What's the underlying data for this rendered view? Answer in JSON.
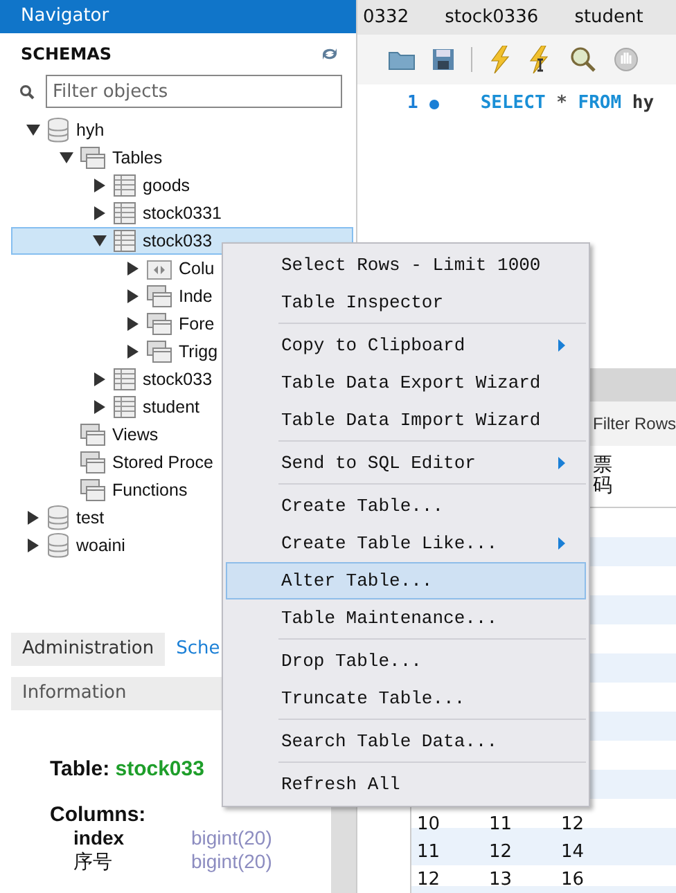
{
  "navigator": {
    "title": "Navigator",
    "section": "SCHEMAS",
    "filter": {
      "placeholder": "Filter objects"
    }
  },
  "tree": [
    {
      "label": "hyh",
      "kind": "schema",
      "expanded": true,
      "selected": false,
      "children": [
        {
          "label": "Tables",
          "kind": "folder",
          "expanded": true,
          "selected": false,
          "children": [
            {
              "label": "goods",
              "kind": "table",
              "expanded": false,
              "selected": false
            },
            {
              "label": "stock0331",
              "kind": "table",
              "expanded": false,
              "selected": false
            },
            {
              "label": "stock033",
              "kind": "table",
              "expanded": true,
              "selected": true,
              "children": [
                {
                  "label": "Colu",
                  "kind": "columns",
                  "expanded": false,
                  "selected": false
                },
                {
                  "label": "Inde",
                  "kind": "folder",
                  "expanded": false,
                  "selected": false
                },
                {
                  "label": "Fore",
                  "kind": "folder",
                  "expanded": false,
                  "selected": false
                },
                {
                  "label": "Trigg",
                  "kind": "folder",
                  "expanded": false,
                  "selected": false
                }
              ]
            },
            {
              "label": "stock033",
              "kind": "table",
              "expanded": false,
              "selected": false
            },
            {
              "label": "student",
              "kind": "table",
              "expanded": false,
              "selected": false
            }
          ]
        },
        {
          "label": "Views",
          "kind": "leaf",
          "selected": false
        },
        {
          "label": "Stored Proce",
          "kind": "leaf",
          "selected": false
        },
        {
          "label": "Functions",
          "kind": "leaf",
          "selected": false
        }
      ]
    },
    {
      "label": "test",
      "kind": "schema",
      "expanded": false,
      "selected": false
    },
    {
      "label": "woaini",
      "kind": "schema",
      "expanded": false,
      "selected": false
    }
  ],
  "bottom_tabs": [
    {
      "label": "Administration",
      "selected": true
    },
    {
      "label": "Sche",
      "selected": false
    }
  ],
  "information": {
    "title": "Information",
    "table_label": "Table:",
    "table_name": "stock033",
    "columns_label": "Columns:",
    "columns": [
      {
        "name": "index",
        "type": "bigint(20)"
      },
      {
        "name": "序号",
        "type": "bigint(20)"
      }
    ]
  },
  "editor_tabs": [
    {
      "label": "0332",
      "selected": false
    },
    {
      "label": "stock0336",
      "selected": false
    },
    {
      "label": "student",
      "selected": false
    }
  ],
  "editor": {
    "line_number": "1",
    "keyword_1": "SELECT",
    "star": "*",
    "keyword_2": "FROM",
    "rest": "hy"
  },
  "results": {
    "filter_label": "Filter Rows",
    "column_header": "票码",
    "rows": [
      [
        "10",
        "11",
        "12"
      ],
      [
        "11",
        "12",
        "14"
      ],
      [
        "12",
        "13",
        "16"
      ]
    ]
  },
  "context_menu": [
    {
      "kind": "item",
      "label": "Select Rows - Limit 1000",
      "submenu": false,
      "selected": false
    },
    {
      "kind": "item",
      "label": "Table Inspector",
      "submenu": false,
      "selected": false
    },
    {
      "kind": "separator"
    },
    {
      "kind": "item",
      "label": "Copy to Clipboard",
      "submenu": true,
      "selected": false
    },
    {
      "kind": "item",
      "label": "Table Data Export Wizard",
      "submenu": false,
      "selected": false
    },
    {
      "kind": "item",
      "label": "Table Data Import Wizard",
      "submenu": false,
      "selected": false
    },
    {
      "kind": "separator"
    },
    {
      "kind": "item",
      "label": "Send to SQL Editor",
      "submenu": true,
      "selected": false
    },
    {
      "kind": "separator"
    },
    {
      "kind": "item",
      "label": "Create Table...",
      "submenu": false,
      "selected": false
    },
    {
      "kind": "item",
      "label": "Create Table Like...",
      "submenu": true,
      "selected": false
    },
    {
      "kind": "item",
      "label": "Alter Table...",
      "submenu": false,
      "selected": true
    },
    {
      "kind": "item",
      "label": "Table Maintenance...",
      "submenu": false,
      "selected": false
    },
    {
      "kind": "separator"
    },
    {
      "kind": "item",
      "label": "Drop Table...",
      "submenu": false,
      "selected": false
    },
    {
      "kind": "item",
      "label": "Truncate Table...",
      "submenu": false,
      "selected": false
    },
    {
      "kind": "separator"
    },
    {
      "kind": "item",
      "label": "Search Table Data...",
      "submenu": false,
      "selected": false
    },
    {
      "kind": "separator"
    },
    {
      "kind": "item",
      "label": "Refresh All",
      "submenu": false,
      "selected": false
    }
  ]
}
